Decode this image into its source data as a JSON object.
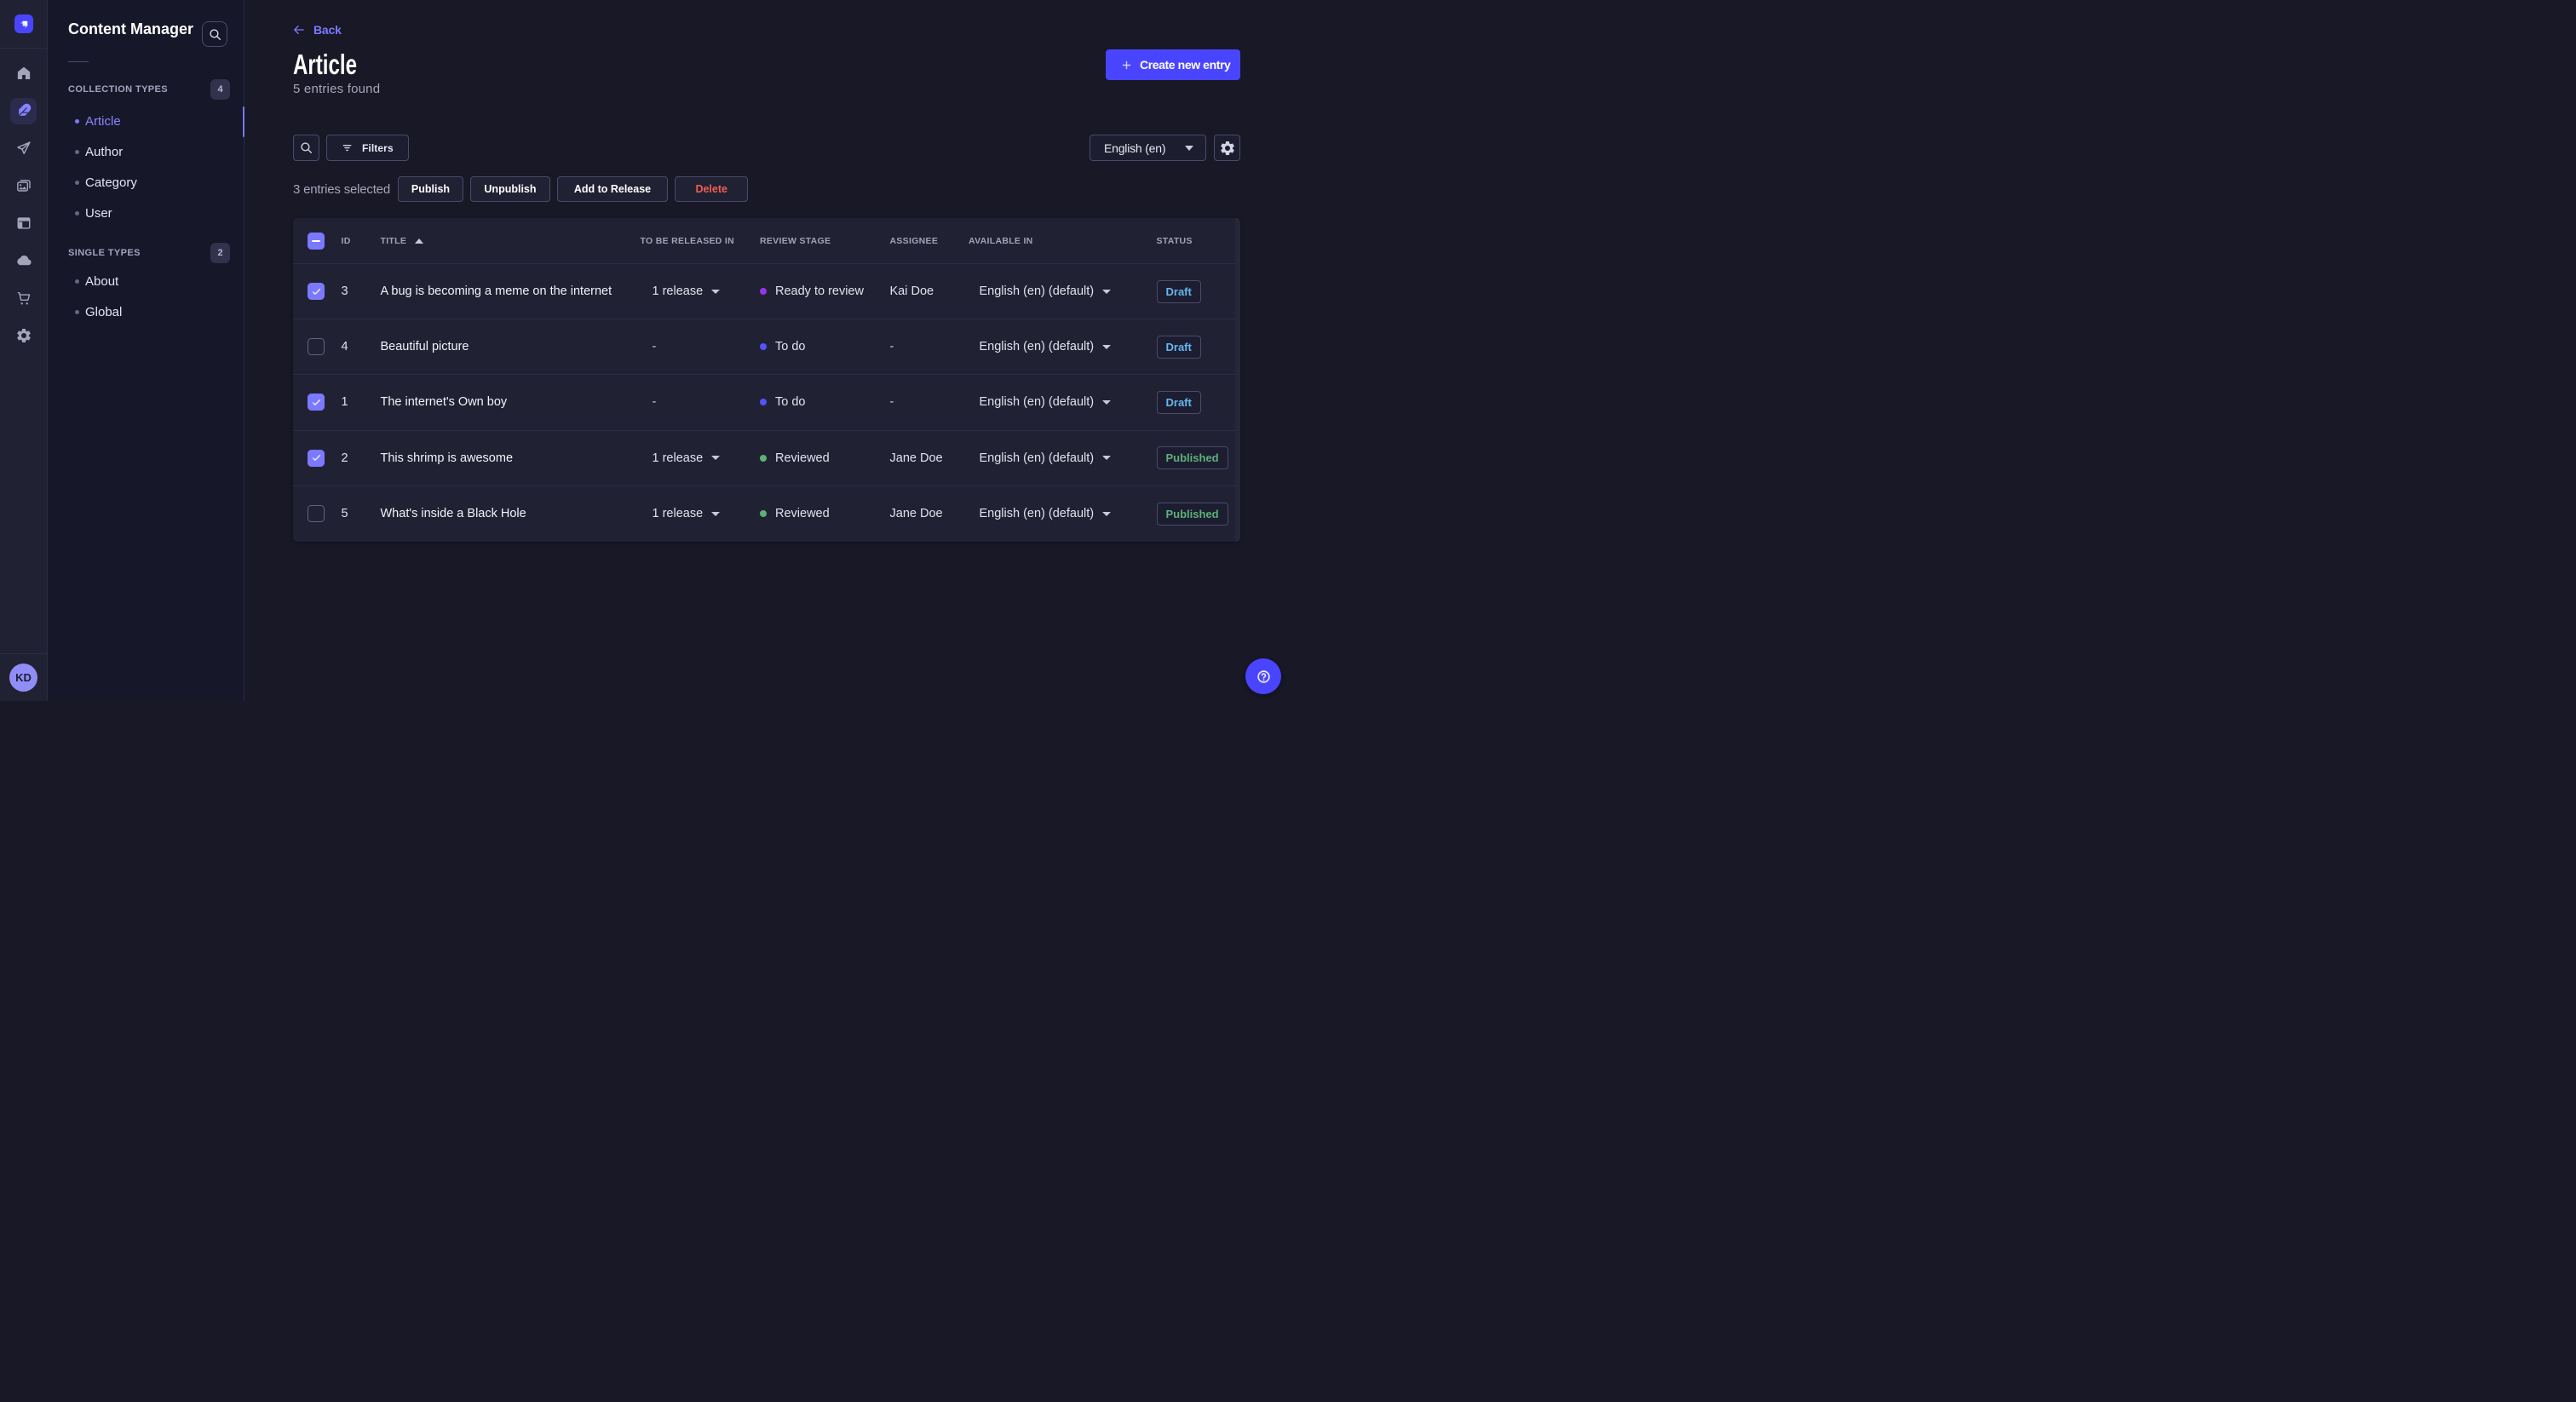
{
  "colors": {
    "accent": "#4945ff",
    "accent_light": "#7b79ff",
    "page_bg": "#181826",
    "panel_bg": "#212134",
    "danger": "#ee5e52",
    "success": "#5cb176",
    "secondary": "#66b7f1"
  },
  "rail": {
    "logo_icon": "strapi-logo",
    "items": [
      {
        "icon": "home-icon",
        "name": "home",
        "active": false
      },
      {
        "icon": "feather-icon",
        "name": "content-manager",
        "active": true
      },
      {
        "icon": "paper-plane-icon",
        "name": "releases",
        "active": false
      },
      {
        "icon": "images-icon",
        "name": "media-library",
        "active": false
      },
      {
        "icon": "layout-icon",
        "name": "content-type-builder",
        "active": false
      },
      {
        "icon": "cloud-icon",
        "name": "deploy",
        "active": false
      },
      {
        "icon": "cart-icon",
        "name": "marketplace",
        "active": false
      },
      {
        "icon": "gear-icon",
        "name": "settings",
        "active": false
      }
    ],
    "avatar_initials": "KD"
  },
  "subnav": {
    "title": "Content Manager",
    "search_icon": "search-icon",
    "sections": [
      {
        "label": "COLLECTION TYPES",
        "badge": "4",
        "items": [
          {
            "label": "Article",
            "active": true
          },
          {
            "label": "Author",
            "active": false
          },
          {
            "label": "Category",
            "active": false
          },
          {
            "label": "User",
            "active": false
          }
        ]
      },
      {
        "label": "SINGLE TYPES",
        "badge": "2",
        "items": [
          {
            "label": "About",
            "active": false
          },
          {
            "label": "Global",
            "active": false
          }
        ]
      }
    ]
  },
  "header": {
    "back_label": "Back",
    "title": "Article",
    "subtitle": "5 entries found",
    "create_label": "Create new entry"
  },
  "toolbar": {
    "search_icon": "search-icon",
    "filters_label": "Filters",
    "locale_value": "English (en)",
    "settings_icon": "gear-icon"
  },
  "selection": {
    "text": "3 entries selected",
    "actions": [
      {
        "label": "Publish",
        "danger": false,
        "width": 77
      },
      {
        "label": "Unpublish",
        "danger": false,
        "width": 94
      },
      {
        "label": "Add to Release",
        "danger": false,
        "width": 130
      },
      {
        "label": "Delete",
        "danger": true,
        "width": 86.5
      }
    ]
  },
  "table": {
    "columns": {
      "id": "ID",
      "title": "TITLE",
      "release": "TO BE RELEASED IN",
      "review_stage": "REVIEW STAGE",
      "assignee": "ASSIGNEE",
      "available_in": "AVAILABLE IN",
      "status": "STATUS"
    },
    "sorted_by": "TITLE",
    "sort_direction": "asc",
    "rows": [
      {
        "checked": true,
        "id": "3",
        "title": "A bug is becoming a meme on the internet",
        "release": "1 release",
        "stage": "Ready to review",
        "stage_color": "#9736e8",
        "assignee": "Kai Doe",
        "locale": "English (en) (default)",
        "status": "Draft",
        "status_color": "#66b7f1"
      },
      {
        "checked": false,
        "id": "4",
        "title": "Beautiful picture",
        "release": "-",
        "stage": "To do",
        "stage_color": "#5552ff",
        "assignee": "-",
        "locale": "English (en) (default)",
        "status": "Draft",
        "status_color": "#66b7f1"
      },
      {
        "checked": true,
        "id": "1",
        "title": "The internet's Own boy",
        "release": "-",
        "stage": "To do",
        "stage_color": "#5552ff",
        "assignee": "-",
        "locale": "English (en) (default)",
        "status": "Draft",
        "status_color": "#66b7f1"
      },
      {
        "checked": true,
        "id": "2",
        "title": "This shrimp is awesome",
        "release": "1 release",
        "stage": "Reviewed",
        "stage_color": "#5cb176",
        "assignee": "Jane Doe",
        "locale": "English (en) (default)",
        "status": "Published",
        "status_color": "#5cb176"
      },
      {
        "checked": false,
        "id": "5",
        "title": "What's inside a Black Hole",
        "release": "1 release",
        "stage": "Reviewed",
        "stage_color": "#5cb176",
        "assignee": "Jane Doe",
        "locale": "English (en) (default)",
        "status": "Published",
        "status_color": "#5cb176"
      }
    ]
  },
  "help": {
    "icon": "question-circle-icon"
  }
}
